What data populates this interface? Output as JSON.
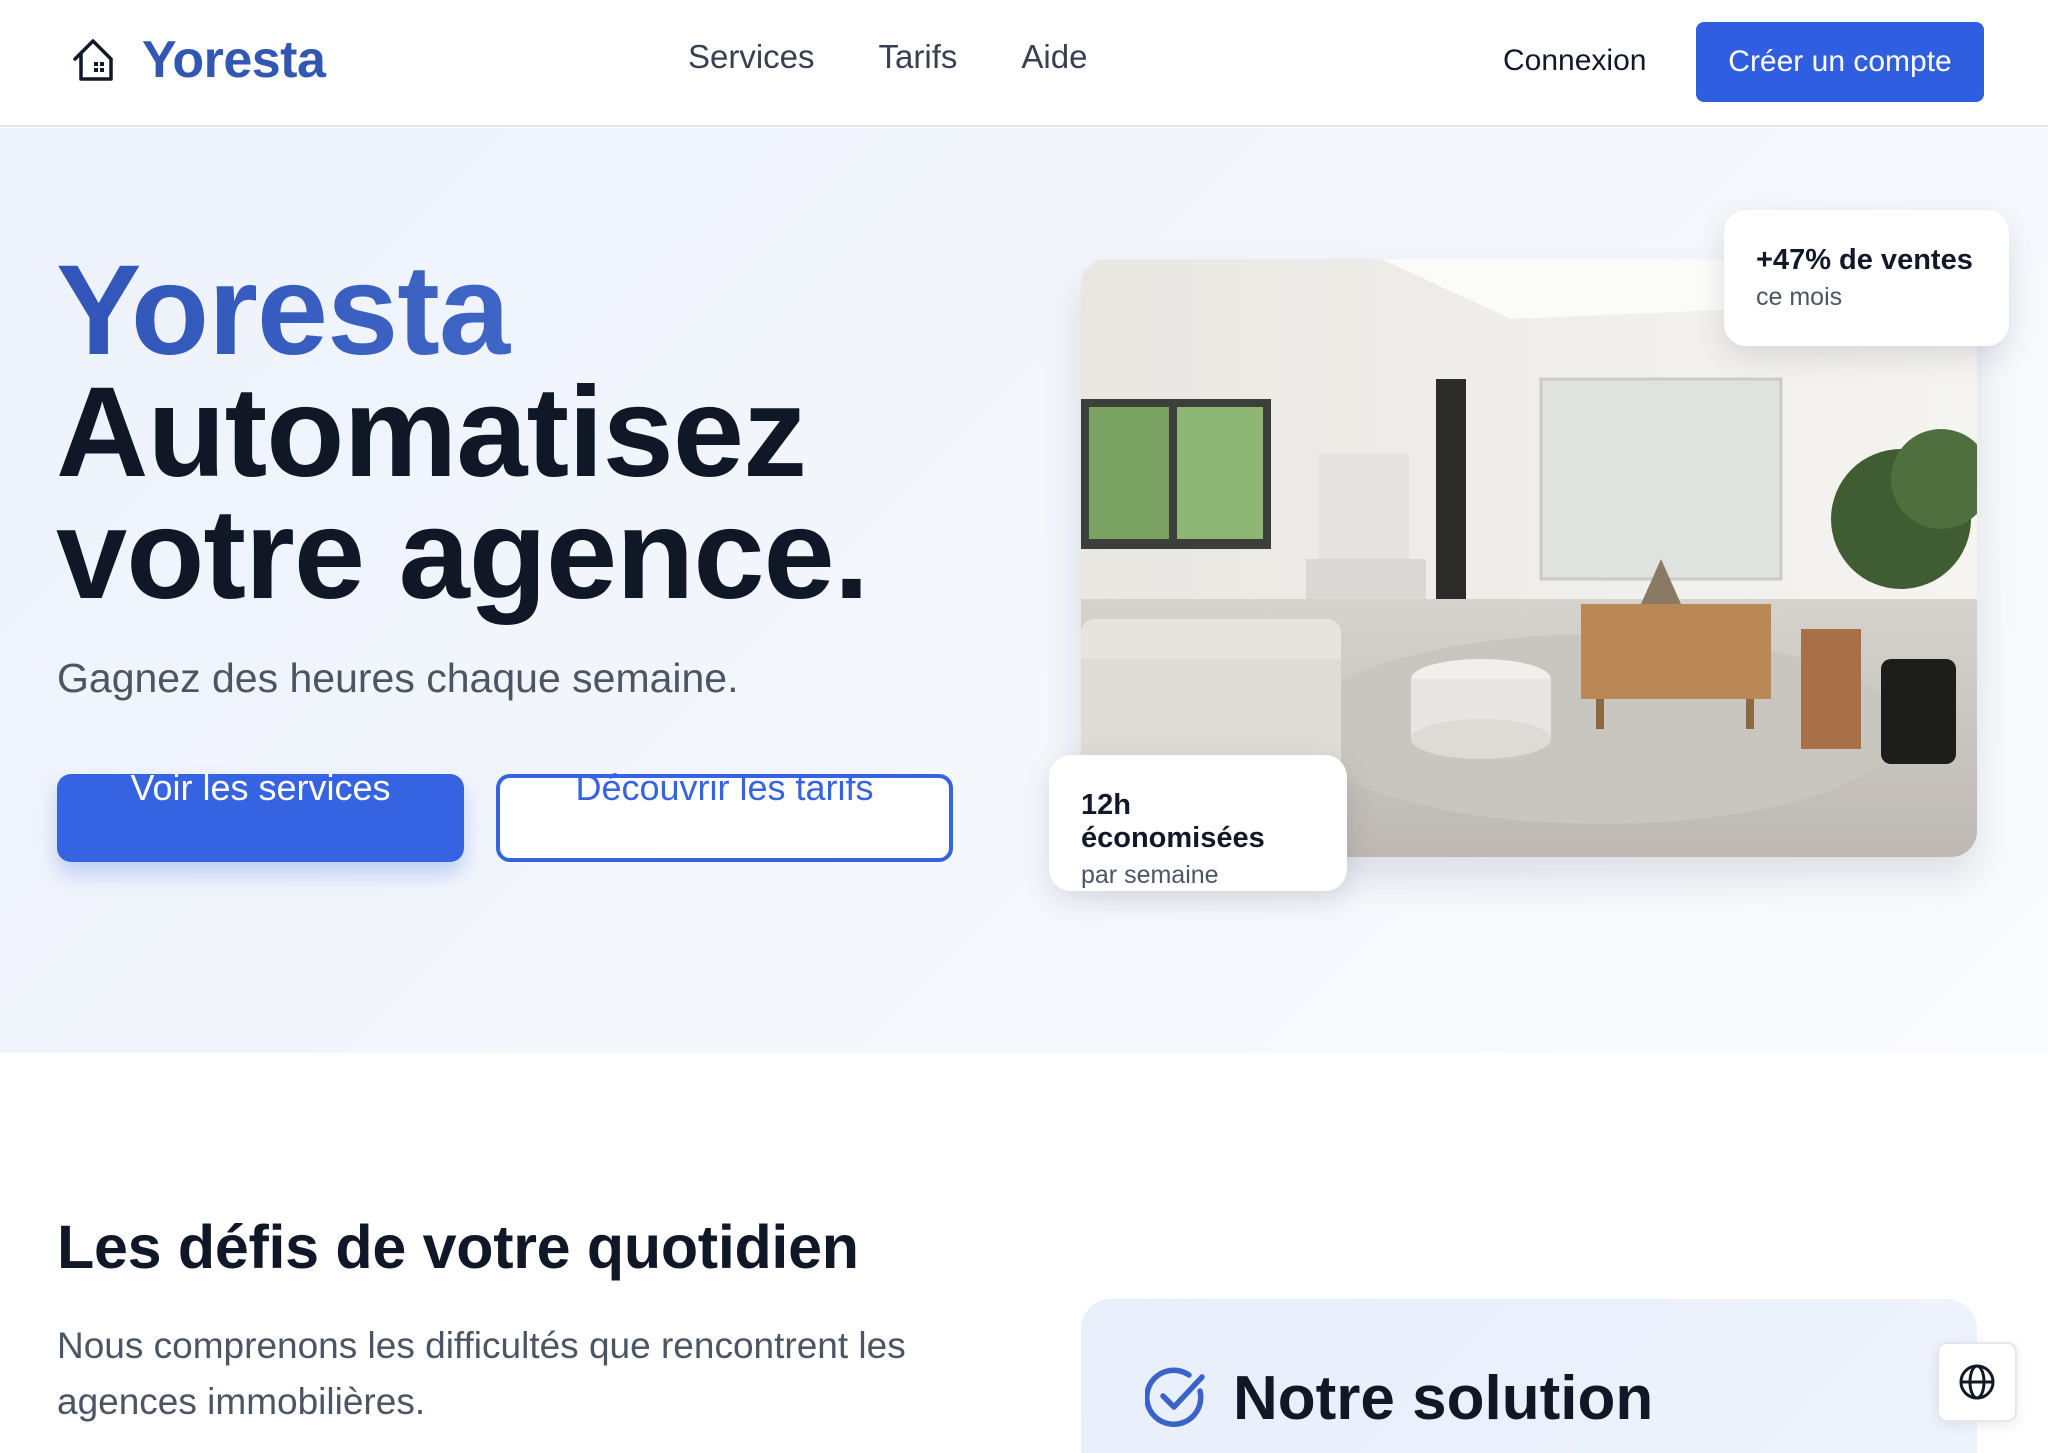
{
  "header": {
    "brand": "Yoresta",
    "nav": [
      "Services",
      "Tarifs",
      "Aide"
    ],
    "login": "Connexion",
    "signup": "Créer un compte"
  },
  "hero": {
    "brand": "Yoresta",
    "line1": "Automatisez",
    "line2": "votre agence.",
    "subtitle": "Gagnez des heures chaque semaine.",
    "primary_cta": "Voir les services",
    "secondary_cta": "Découvrir les tarifs",
    "stat_sales": {
      "value": "+47% de ventes",
      "caption": "ce mois"
    },
    "stat_hours": {
      "value": "12h économisées",
      "caption": "par semaine"
    }
  },
  "challenges": {
    "title": "Les défis de votre quotidien",
    "subtitle": "Nous comprenons les difficultés que rencontrent les agences immobilières."
  },
  "solution": {
    "title": "Notre solution"
  },
  "colors": {
    "accent": "#3563e2",
    "brand": "#3257b3",
    "text": "#101828",
    "muted": "#4b5563"
  },
  "icons": {
    "logo": "house-icon",
    "solution": "check-circle-icon",
    "language": "globe-icon"
  }
}
